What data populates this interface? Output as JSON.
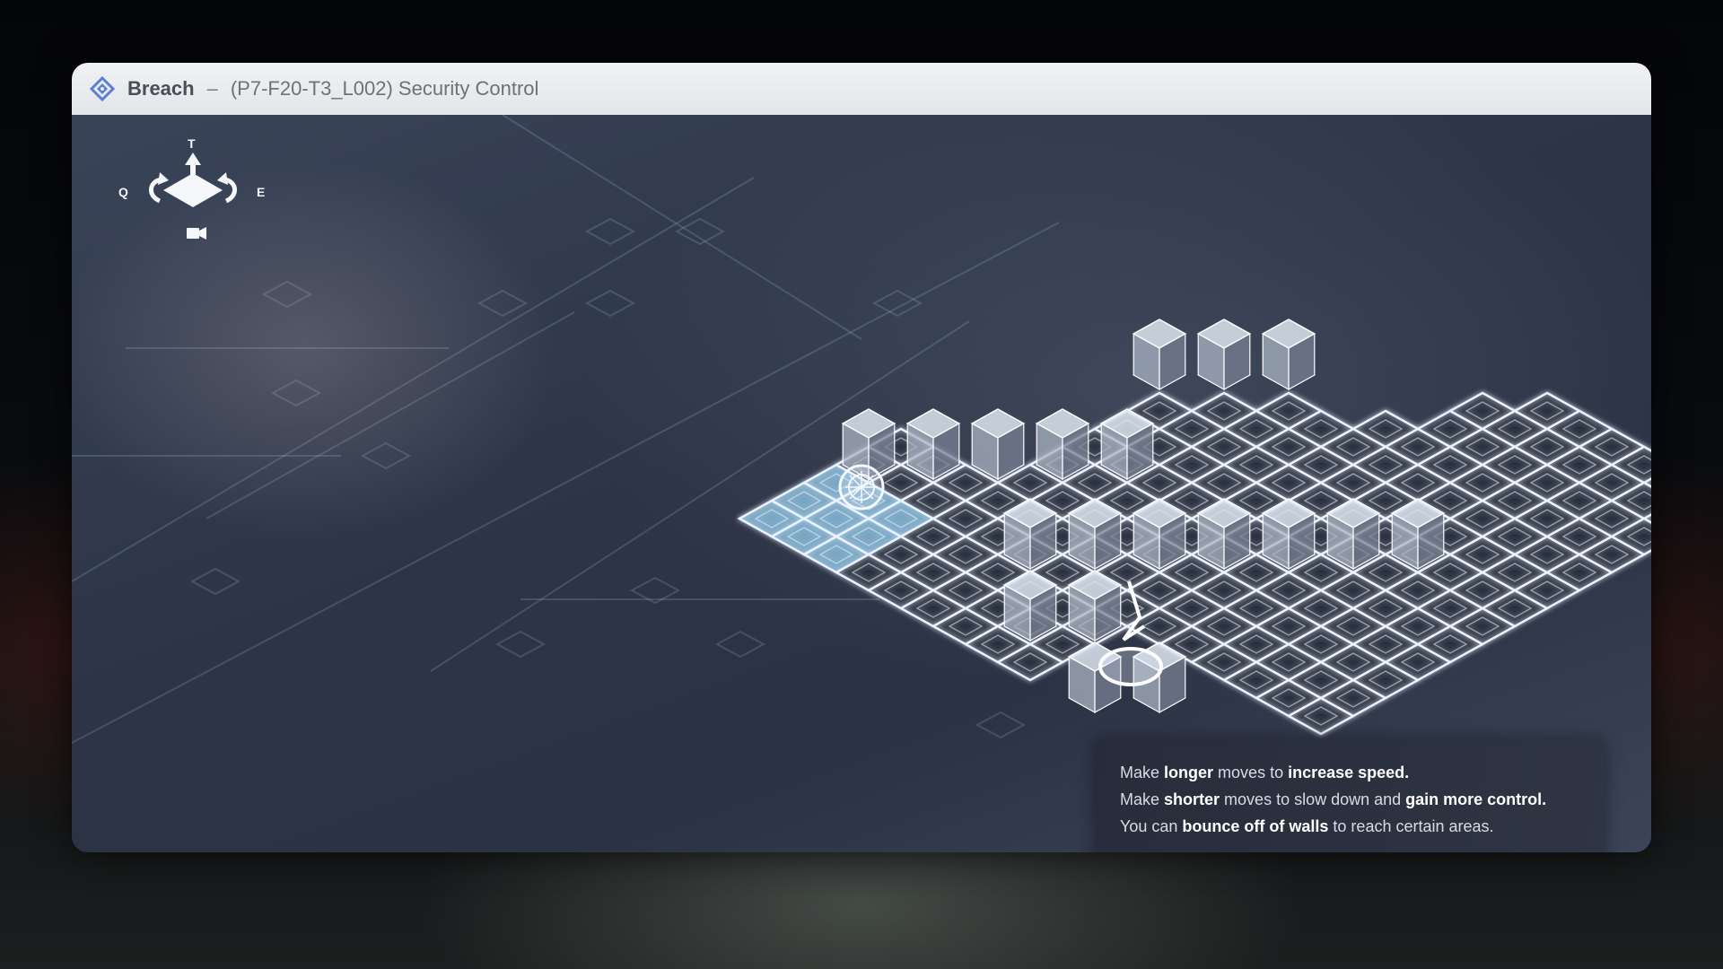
{
  "window": {
    "app_name": "Breach",
    "separator": "–",
    "level_name": "(P7-F20-T3_L002) Security Control",
    "app_icon": "diamond-gear-icon",
    "accent_color": "#5a7fd6"
  },
  "camera_controls": {
    "tilt_key": "T",
    "rotate_left_key": "Q",
    "rotate_right_key": "E",
    "icons": [
      "tilt-arrow-icon",
      "rotate-left-icon",
      "rotate-right-icon",
      "camera-icon"
    ]
  },
  "hint": {
    "line1": {
      "a": "Make ",
      "b": "longer",
      "c": " moves to ",
      "d": "increase speed."
    },
    "line2": {
      "a": "Make ",
      "b": "shorter",
      "c": " moves to slow down and ",
      "d": "gain more control."
    },
    "line3": {
      "a": "You can ",
      "b": "bounce off of walls",
      "c": " to reach certain areas."
    },
    "progress": 1.0
  },
  "colors": {
    "grid_glow": "#eaf2ff",
    "highlight_tile": "#8fc6e6",
    "background": "#2c3446"
  }
}
